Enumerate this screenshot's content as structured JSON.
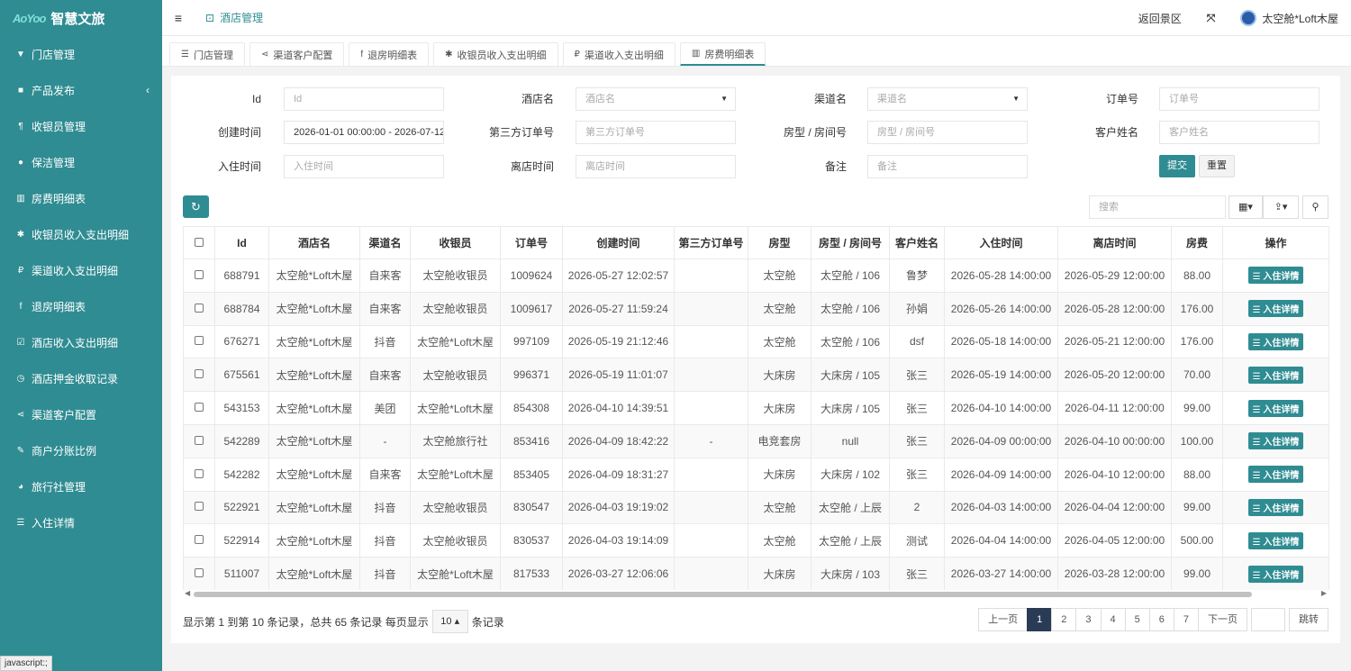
{
  "brand": {
    "mark": "AoYoo",
    "name": "智慧文旅"
  },
  "sidebar": {
    "items": [
      {
        "icon": "filter-icon",
        "glyph": "▼",
        "label": "门店管理"
      },
      {
        "icon": "product-icon",
        "glyph": "■",
        "label": "产品发布",
        "arrow": "‹"
      },
      {
        "icon": "paragraph-icon",
        "glyph": "¶",
        "label": "收银员管理"
      },
      {
        "icon": "user-icon",
        "glyph": "●",
        "label": "保洁管理"
      },
      {
        "icon": "bar-chart-icon",
        "glyph": "▥",
        "label": "房费明细表"
      },
      {
        "icon": "magic-icon",
        "glyph": "✱",
        "label": "收银员收入支出明细"
      },
      {
        "icon": "ruble-icon",
        "glyph": "₽",
        "label": "渠道收入支出明细"
      },
      {
        "icon": "facebook-icon",
        "glyph": "f",
        "label": "退房明细表"
      },
      {
        "icon": "check-square-icon",
        "glyph": "☑",
        "label": "酒店收入支出明细"
      },
      {
        "icon": "clock-icon",
        "glyph": "◷",
        "label": "酒店押金收取记录"
      },
      {
        "icon": "share-icon",
        "glyph": "⋖",
        "label": "渠道客户配置"
      },
      {
        "icon": "pen-icon",
        "glyph": "✎",
        "label": "商户分账比例"
      },
      {
        "icon": "globe-icon",
        "glyph": "◕",
        "label": "旅行社管理"
      },
      {
        "icon": "list-icon",
        "glyph": "☰",
        "label": "入住详情"
      }
    ]
  },
  "topbar": {
    "menu_glyph": "≡",
    "tab_glyph": "⊡",
    "tab_label": "酒店管理",
    "return_label": "返回景区",
    "fullscreen_glyph": "⤧",
    "user_name": "太空舱*Loft木屋"
  },
  "tabs": [
    {
      "glyph": "☰",
      "label": "门店管理"
    },
    {
      "glyph": "⋖",
      "label": "渠道客户配置"
    },
    {
      "glyph": "f",
      "label": "退房明细表"
    },
    {
      "glyph": "✱",
      "label": "收银员收入支出明细"
    },
    {
      "glyph": "₽",
      "label": "渠道收入支出明细"
    },
    {
      "glyph": "▥",
      "label": "房费明细表",
      "active": true
    }
  ],
  "filters": {
    "id": {
      "label": "Id",
      "placeholder": "Id"
    },
    "hotel": {
      "label": "酒店名",
      "placeholder": "酒店名"
    },
    "channel": {
      "label": "渠道名",
      "placeholder": "渠道名"
    },
    "order": {
      "label": "订单号",
      "placeholder": "订单号"
    },
    "created": {
      "label": "创建时间",
      "value": "2026-01-01 00:00:00 - 2026-07-12"
    },
    "third": {
      "label": "第三方订单号",
      "placeholder": "第三方订单号"
    },
    "room": {
      "label": "房型 / 房间号",
      "placeholder": "房型 / 房间号"
    },
    "customer": {
      "label": "客户姓名",
      "placeholder": "客户姓名"
    },
    "checkin": {
      "label": "入住时间",
      "placeholder": "入住时间"
    },
    "checkout": {
      "label": "离店时间",
      "placeholder": "离店时间"
    },
    "remark": {
      "label": "备注",
      "placeholder": "备注"
    },
    "submit": "提交",
    "reset": "重置"
  },
  "toolbar": {
    "refresh_glyph": "↻",
    "search_placeholder": "搜索",
    "columns_glyph": "▦▾",
    "export_glyph": "⇪▾",
    "search_glyph": "⚲"
  },
  "table": {
    "headers": [
      "Id",
      "酒店名",
      "渠道名",
      "收银员",
      "订单号",
      "创建时间",
      "第三方订单号",
      "房型",
      "房型 / 房间号",
      "客户姓名",
      "入住时间",
      "离店时间",
      "房费",
      "操作"
    ],
    "action_label": "☰ 入住详情",
    "rows": [
      [
        "688791",
        "太空舱*Loft木屋",
        "自来客",
        "太空舱收银员",
        "1009624",
        "2026-05-27 12:02:57",
        "",
        "太空舱",
        "太空舱 / 106",
        "鲁梦",
        "2026-05-28 14:00:00",
        "2026-05-29 12:00:00",
        "88.00"
      ],
      [
        "688784",
        "太空舱*Loft木屋",
        "自来客",
        "太空舱收银员",
        "1009617",
        "2026-05-27 11:59:24",
        "",
        "太空舱",
        "太空舱 / 106",
        "孙娟",
        "2026-05-26 14:00:00",
        "2026-05-28 12:00:00",
        "176.00"
      ],
      [
        "676271",
        "太空舱*Loft木屋",
        "抖音",
        "太空舱*Loft木屋",
        "997109",
        "2026-05-19 21:12:46",
        "",
        "太空舱",
        "太空舱 / 106",
        "dsf",
        "2026-05-18 14:00:00",
        "2026-05-21 12:00:00",
        "176.00"
      ],
      [
        "675561",
        "太空舱*Loft木屋",
        "自来客",
        "太空舱收银员",
        "996371",
        "2026-05-19 11:01:07",
        "",
        "大床房",
        "大床房 / 105",
        "张三",
        "2026-05-19 14:00:00",
        "2026-05-20 12:00:00",
        "70.00"
      ],
      [
        "543153",
        "太空舱*Loft木屋",
        "美团",
        "太空舱*Loft木屋",
        "854308",
        "2026-04-10 14:39:51",
        "",
        "大床房",
        "大床房 / 105",
        "张三",
        "2026-04-10 14:00:00",
        "2026-04-11 12:00:00",
        "99.00"
      ],
      [
        "542289",
        "太空舱*Loft木屋",
        "-",
        "太空舱旅行社",
        "853416",
        "2026-04-09 18:42:22",
        "-",
        "电竞套房",
        "null",
        "张三",
        "2026-04-09 00:00:00",
        "2026-04-10 00:00:00",
        "100.00"
      ],
      [
        "542282",
        "太空舱*Loft木屋",
        "自来客",
        "太空舱*Loft木屋",
        "853405",
        "2026-04-09 18:31:27",
        "",
        "大床房",
        "大床房 / 102",
        "张三",
        "2026-04-09 14:00:00",
        "2026-04-10 12:00:00",
        "88.00"
      ],
      [
        "522921",
        "太空舱*Loft木屋",
        "抖音",
        "太空舱收银员",
        "830547",
        "2026-04-03 19:19:02",
        "",
        "太空舱",
        "太空舱 / 上辰",
        "2",
        "2026-04-03 14:00:00",
        "2026-04-04 12:00:00",
        "99.00"
      ],
      [
        "522914",
        "太空舱*Loft木屋",
        "抖音",
        "太空舱收银员",
        "830537",
        "2026-04-03 19:14:09",
        "",
        "太空舱",
        "太空舱 / 上辰",
        "测试",
        "2026-04-04 14:00:00",
        "2026-04-05 12:00:00",
        "500.00"
      ],
      [
        "511007",
        "太空舱*Loft木屋",
        "抖音",
        "太空舱*Loft木屋",
        "817533",
        "2026-03-27 12:06:06",
        "",
        "大床房",
        "大床房 / 103",
        "张三",
        "2026-03-27 14:00:00",
        "2026-03-28 12:00:00",
        "99.00"
      ]
    ]
  },
  "footer": {
    "info_prefix": "显示第 1 到第 10 条记录，总共 65 条记录 每页显示",
    "page_size": "10 ▴",
    "info_suffix": "条记录"
  },
  "pagination": {
    "prev": "上一页",
    "pages": [
      "1",
      "2",
      "3",
      "4",
      "5",
      "6",
      "7"
    ],
    "current": "1",
    "next": "下一页",
    "jump": "跳转"
  },
  "status_bar": "javascript:;"
}
